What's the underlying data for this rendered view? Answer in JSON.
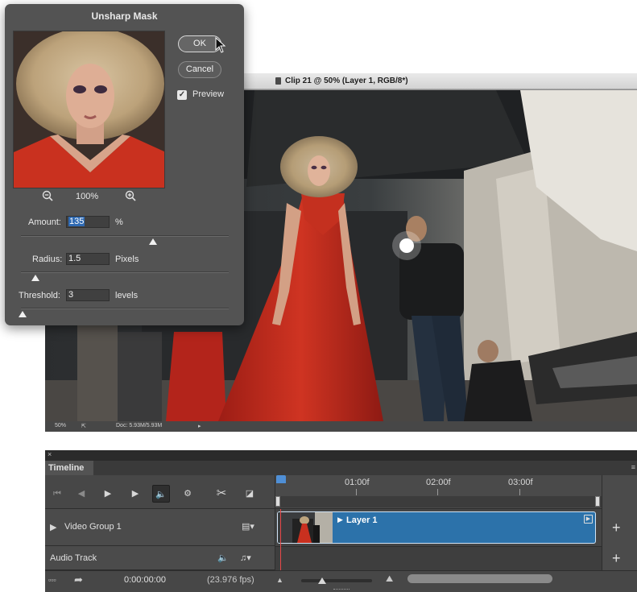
{
  "document": {
    "title": "Clip 21 @ 50% (Layer 1, RGB/8*)",
    "status": {
      "zoom": "50%",
      "doc_size": "Doc: 5.93M/5.93M"
    }
  },
  "dialog": {
    "title": "Unsharp Mask",
    "ok_label": "OK",
    "cancel_label": "Cancel",
    "preview_label": "Preview",
    "preview_checked": true,
    "zoom_value": "100%",
    "amount": {
      "label": "Amount:",
      "value": "135",
      "unit": "%",
      "slider_fraction": 0.54
    },
    "radius": {
      "label": "Radius:",
      "value": "1.5",
      "unit": "Pixels",
      "slider_fraction": 0.06
    },
    "threshold": {
      "label": "Threshold:",
      "value": "3",
      "unit": "levels",
      "slider_fraction": 0.01
    }
  },
  "timeline": {
    "tab_label": "Timeline",
    "close_glyph": "×",
    "menu_glyph": "≡",
    "ruler_labels": [
      "01:00f",
      "02:00f",
      "03:00f"
    ],
    "tracks": [
      {
        "label": "Video Group 1",
        "icon": "film-strip-icon"
      },
      {
        "label": "Audio Track",
        "icon": "speaker-icon"
      }
    ],
    "clip_label": "Layer 1",
    "current_time": "0:00:00:00",
    "fps": "(23.976 fps)",
    "controls": [
      "go-to-first-frame",
      "previous-frame",
      "play",
      "next-frame",
      "mute-audio",
      "settings",
      "split-at-playhead",
      "transition"
    ]
  }
}
